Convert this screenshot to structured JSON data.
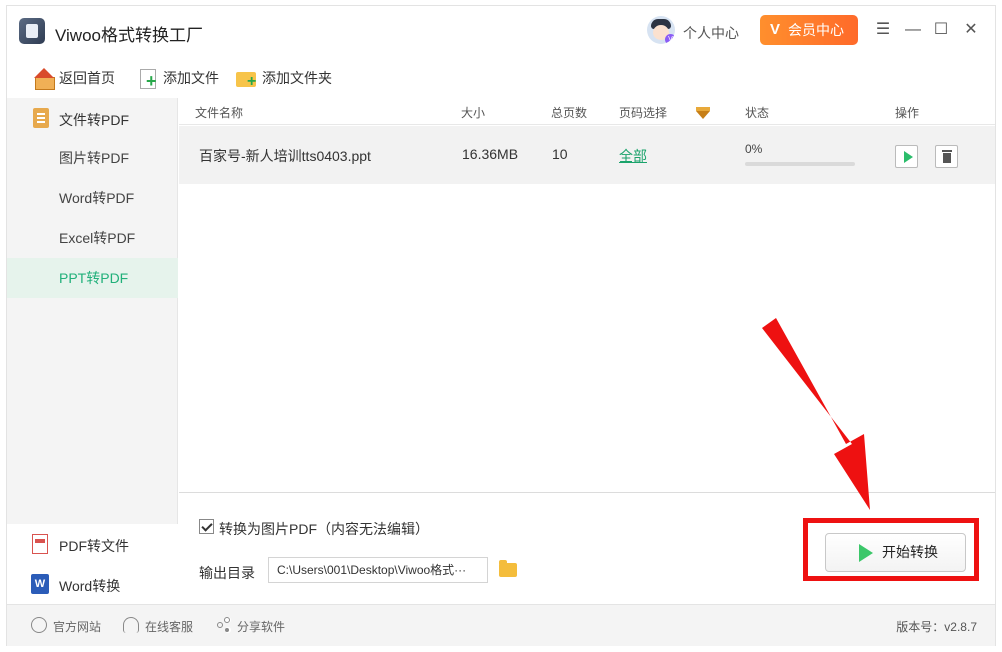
{
  "app": {
    "title": "Viwoo格式转换工厂"
  },
  "header": {
    "personal_center": "个人中心",
    "vip_center": "会员中心",
    "vip_badge": "V"
  },
  "toolbar": {
    "home": "返回首页",
    "add_file": "添加文件",
    "add_folder": "添加文件夹"
  },
  "sidebar": {
    "group_label": "文件转PDF",
    "items": [
      {
        "label": "图片转PDF"
      },
      {
        "label": "Word转PDF"
      },
      {
        "label": "Excel转PDF"
      },
      {
        "label": "PPT转PDF",
        "active": true
      }
    ],
    "bottom": [
      {
        "label": "PDF转文件",
        "icon": "pdf-icon"
      },
      {
        "label": "Word转换",
        "icon": "word-icon",
        "glyph": "W"
      }
    ]
  },
  "table": {
    "headers": {
      "name": "文件名称",
      "size": "大小",
      "pages": "总页数",
      "page_select": "页码选择",
      "status": "状态",
      "actions": "操作"
    },
    "rows": [
      {
        "name": "百家号-新人培训tts0403.ppt",
        "size": "16.36MB",
        "pages": "10",
        "page_select": "全部",
        "status": "0%",
        "progress": 0
      }
    ]
  },
  "options": {
    "to_image_pdf": "转换为图片PDF（内容无法编辑）",
    "to_image_pdf_checked": true,
    "output_label": "输出目录",
    "output_path": "C:\\Users\\001\\Desktop\\Viwoo格式···"
  },
  "actions": {
    "start": "开始转换"
  },
  "footer": {
    "website": "官方网站",
    "support": "在线客服",
    "share": "分享软件",
    "version": "版本号：v2.8.7"
  },
  "colors": {
    "accent": "#21b07a",
    "vip": "#ff7a2b",
    "annotation": "#ee1111"
  }
}
